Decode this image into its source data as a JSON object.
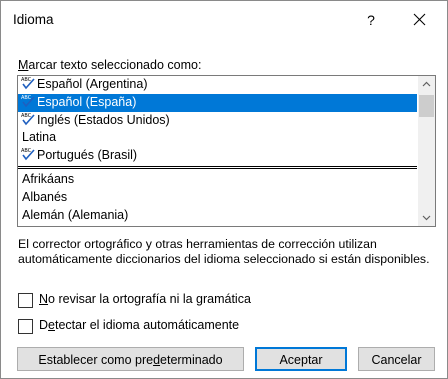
{
  "dialog": {
    "title": "Idioma",
    "help_glyph": "?",
    "close_icon": "close-icon"
  },
  "mark_label_prefix": "M",
  "mark_label_rest": "arcar texto seleccionado como:",
  "list": {
    "proofing": [
      {
        "label": "Español (Argentina)",
        "icon": "spell-check-icon"
      },
      {
        "label": "Español (España)",
        "icon": "spell-check-icon",
        "selected": true
      },
      {
        "label": "Inglés (Estados Unidos)",
        "icon": "spell-check-icon"
      },
      {
        "label": "Latina"
      },
      {
        "label": "Portugués (Brasil)",
        "icon": "spell-check-icon"
      }
    ],
    "other": [
      {
        "label": "Afrikáans"
      },
      {
        "label": "Albanés"
      },
      {
        "label": "Alemán (Alemania)"
      }
    ]
  },
  "colors": {
    "selection": "#0078d7",
    "button_face": "#e1e1e1",
    "default_button_border": "#0078d7"
  },
  "help_text": "El corrector ortográfico y otras herramientas de corrección utilizan automáticamente diccionarios del idioma seleccionado si están disponibles.",
  "options": {
    "no_check": {
      "acc": "N",
      "rest": "o revisar la ortografía ni la gramática",
      "checked": false
    },
    "detect": {
      "pre": "D",
      "acc": "e",
      "rest": "tectar el idioma automáticamente",
      "checked": false
    }
  },
  "buttons": {
    "set_default": {
      "pre": "Establecer como pre",
      "acc": "d",
      "rest": "eterminado"
    },
    "ok": "Aceptar",
    "cancel": "Cancelar"
  }
}
